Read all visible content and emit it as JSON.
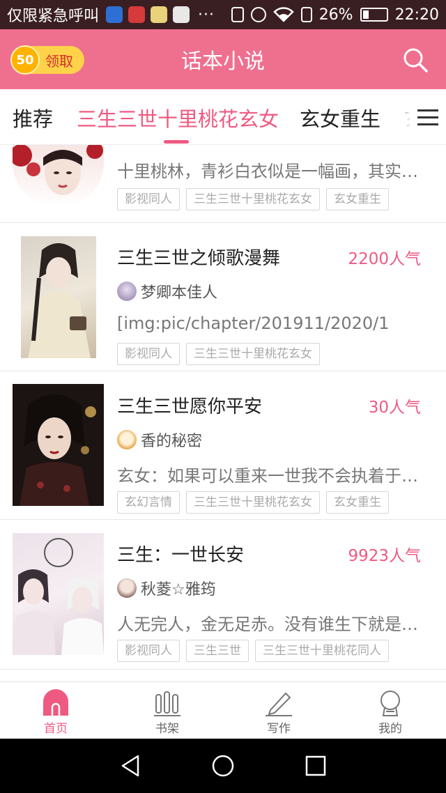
{
  "status_bar": {
    "carrier": "仅限紧急呼叫",
    "more": "···",
    "battery_pct": "26%",
    "battery_level": 0.26,
    "time": "22:20"
  },
  "header": {
    "coin_value": "50",
    "coin_label": "领取",
    "title": "话本小说",
    "accent": "#ef6f8f"
  },
  "tabs": [
    {
      "label": "推荐",
      "active": false
    },
    {
      "label": "三生三世十里桃花玄女",
      "active": true
    },
    {
      "label": "玄女重生",
      "active": false
    },
    {
      "label": "玄",
      "active": false
    }
  ],
  "books": [
    {
      "title": "",
      "popularity": "",
      "author": "",
      "desc": "十里桃林，青衫白衣似是一幅画，其实…",
      "tags": [
        "影视同人",
        "三生三世十里桃花玄女",
        "玄女重生"
      ]
    },
    {
      "title": "三生三世之倾歌漫舞",
      "popularity": "2200人气",
      "author": "梦卿本佳人",
      "desc": "[img:pic/chapter/201911/2020/1",
      "tags": [
        "影视同人",
        "三生三世十里桃花玄女"
      ]
    },
    {
      "title": "三生三世愿你平安",
      "popularity": "30人气",
      "author": "香的秘密",
      "desc": "玄女：如果可以重来一世我不会执着于…",
      "tags": [
        "玄幻言情",
        "三生三世十里桃花玄女",
        "玄女重生"
      ]
    },
    {
      "title": "三生：一世长安",
      "popularity": "9923人气",
      "author": "秋菱☆雅筠",
      "desc": "人无完人，金无足赤。没有谁生下就是…",
      "tags": [
        "影视同人",
        "三生三世",
        "三生三世十里桃花同人"
      ]
    }
  ],
  "bottom_nav": [
    {
      "label": "首页",
      "icon": "home-icon",
      "active": true
    },
    {
      "label": "书架",
      "icon": "bookshelf-icon",
      "active": false
    },
    {
      "label": "写作",
      "icon": "pen-icon",
      "active": false
    },
    {
      "label": "我的",
      "icon": "profile-icon",
      "active": false
    }
  ]
}
